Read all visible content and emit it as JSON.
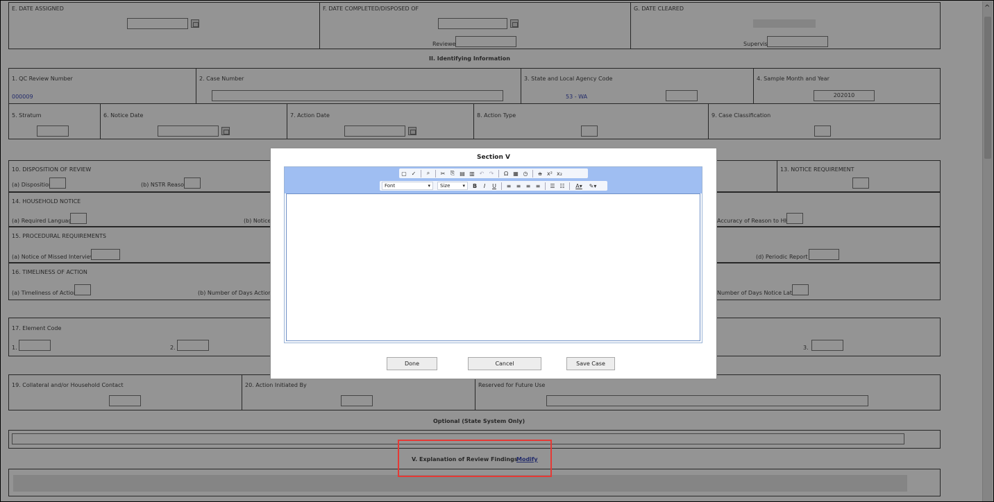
{
  "top_section": {
    "e_label": "E. DATE ASSIGNED",
    "f_label": "F. DATE COMPLETED/DISPOSED OF",
    "g_label": "G. DATE CLEARED",
    "reviewer_label": "Reviewer",
    "supervisor_label": "Supervisor"
  },
  "identifying": {
    "heading": "II. Identifying Information",
    "qc_review_number_label": "1. QC Review Number",
    "qc_review_number_value": "000009",
    "case_number_label": "2. Case Number",
    "agency_code_label": "3. State and Local Agency Code",
    "agency_code_value": "53 - WA",
    "sample_month_label": "4. Sample Month and Year",
    "sample_month_value": "202010",
    "stratum_label": "5. Stratum",
    "notice_date_label": "6. Notice Date",
    "action_date_label": "7. Action Date",
    "action_type_label": "8. Action Type",
    "case_classification_label": "9. Case Classification"
  },
  "disposition": {
    "label": "10. DISPOSITION OF REVIEW",
    "a_label": "(a) Disposition",
    "b_label": "(b) NSTR Reason",
    "notice_requirement_label": "13. NOTICE REQUIREMENT"
  },
  "household_notice": {
    "label": "14. HOUSEHOLD NOTICE",
    "a_label": "(a) Required Language",
    "b_label": "(b) Notice",
    "accuracy_label": "Accuracy of Reason to HH"
  },
  "procedural": {
    "label": "15. PROCEDURAL REQUIREMENTS",
    "a_label": "(a) Notice of Missed Interview",
    "d_label": "(d) Periodic Report"
  },
  "timeliness": {
    "label": "16. TIMELINESS OF ACTION",
    "a_label": "(a) Timeliness of Action",
    "b_label": "(b) Number of Days Action Ea",
    "days_late_label": "Number of Days Notice Late"
  },
  "element_code": {
    "label": "17. Element Code",
    "n1": "1.",
    "n2": "2.",
    "n3": "3."
  },
  "contact": {
    "collateral_label": "19. Collateral and/or Household Contact",
    "initiated_label": "20. Action Initiated By",
    "reserved_label": "Reserved for Future Use"
  },
  "optional": {
    "heading": "Optional (State System Only)"
  },
  "explanation": {
    "heading": "V. Explanation of Review Findings",
    "modify_link": "Modify"
  },
  "dialog": {
    "title": "Section V",
    "font_select": "Font",
    "size_select": "Size",
    "done_button": "Done",
    "cancel_button": "Cancel",
    "save_button": "Save Case"
  },
  "colors": {
    "link": "#3b4ab8",
    "highlight": "#e53935",
    "toolbar": "#9fbef2"
  }
}
